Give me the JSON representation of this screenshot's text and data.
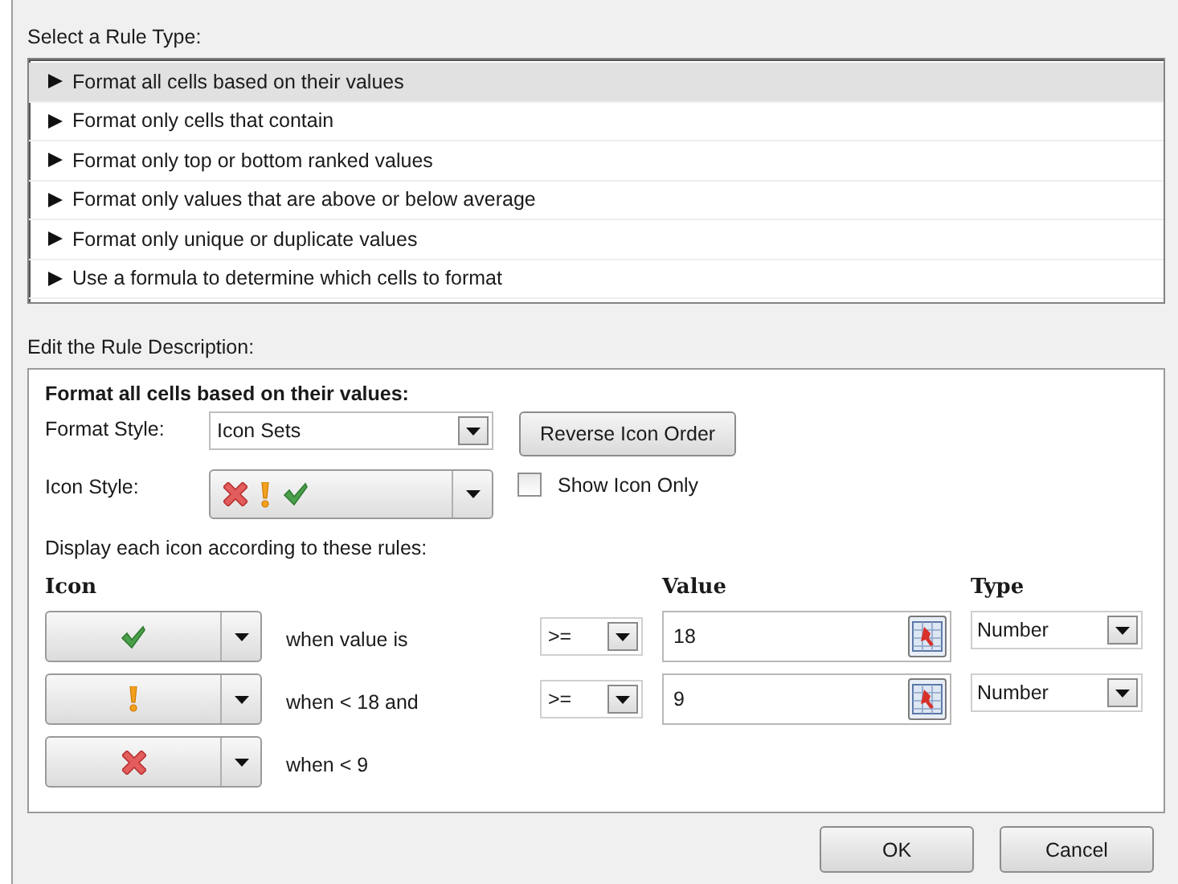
{
  "rule_type": {
    "label": "Select a Rule Type:",
    "items": [
      {
        "text": "Format all cells based on their values",
        "selected": true
      },
      {
        "text": "Format only cells that contain",
        "selected": false
      },
      {
        "text": "Format only top or bottom ranked values",
        "selected": false
      },
      {
        "text": "Format only values that are above or below average",
        "selected": false
      },
      {
        "text": "Format only unique or duplicate values",
        "selected": false
      },
      {
        "text": "Use a formula to determine which cells to format",
        "selected": false
      }
    ]
  },
  "description": {
    "label": "Edit the Rule Description:",
    "heading": "Format all cells based on their values:",
    "format_style": {
      "label": "Format Style:",
      "value": "Icon Sets"
    },
    "reverse_button": "Reverse Icon Order",
    "icon_style": {
      "label": "Icon Style:",
      "icons": [
        {
          "kind": "cross"
        },
        {
          "kind": "exclamation"
        },
        {
          "kind": "check"
        }
      ]
    },
    "show_icon_only": {
      "label": "Show Icon Only",
      "checked": false
    },
    "rules_label": "Display each icon according to these rules:",
    "columns": {
      "icon": "Icon",
      "value": "Value",
      "type": "Type"
    },
    "rules": [
      {
        "kind": "check",
        "condition": "when value is",
        "operator": ">=",
        "value": "18",
        "type": "Number"
      },
      {
        "kind": "exclamation",
        "condition": "when < 18 and",
        "operator": ">=",
        "value": "9",
        "type": "Number"
      },
      {
        "kind": "cross",
        "condition": "when < 9"
      }
    ]
  },
  "buttons": [
    "OK",
    "Cancel"
  ]
}
